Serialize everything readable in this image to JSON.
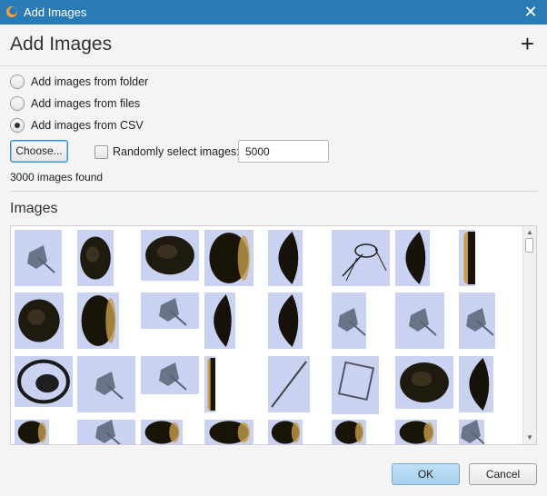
{
  "window": {
    "title": "Add Images",
    "close_glyph": "✕"
  },
  "header": {
    "heading": "Add Images",
    "add_glyph": "+"
  },
  "options": [
    {
      "label": "Add images from folder",
      "checked": false
    },
    {
      "label": "Add images from files",
      "checked": false
    },
    {
      "label": "Add images from CSV",
      "checked": true
    }
  ],
  "choose_button": "Choose...",
  "random": {
    "label": "Randomly select images:",
    "checked": false,
    "value": "5000"
  },
  "status": "3000 images found",
  "images_section": {
    "title": "Images"
  },
  "thumbnails": [
    {
      "kind": "plankton"
    },
    {
      "kind": "dark-round"
    },
    {
      "kind": "dark-round"
    },
    {
      "kind": "dark-oval"
    },
    {
      "kind": "dark-lens"
    },
    {
      "kind": "copepod"
    },
    {
      "kind": "dark-lens"
    },
    {
      "kind": "dark-sliver"
    },
    {
      "kind": "dark-round"
    },
    {
      "kind": "dark-oval"
    },
    {
      "kind": "plankton"
    },
    {
      "kind": "dark-lens"
    },
    {
      "kind": "dark-lens"
    },
    {
      "kind": "plankton"
    },
    {
      "kind": "plankton"
    },
    {
      "kind": "plankton"
    },
    {
      "kind": "ring"
    },
    {
      "kind": "plankton"
    },
    {
      "kind": "plankton"
    },
    {
      "kind": "dark-sliver"
    },
    {
      "kind": "needle"
    },
    {
      "kind": "square"
    },
    {
      "kind": "dark-round"
    },
    {
      "kind": "dark-lens"
    },
    {
      "kind": "dark-oval"
    },
    {
      "kind": "plankton"
    },
    {
      "kind": "dark-oval"
    },
    {
      "kind": "dark-oval"
    },
    {
      "kind": "dark-oval"
    },
    {
      "kind": "dark-oval"
    },
    {
      "kind": "dark-oval"
    },
    {
      "kind": "plankton"
    }
  ],
  "footer": {
    "ok": "OK",
    "cancel": "Cancel"
  },
  "colors": {
    "titlebar": "#2a7ab6",
    "ok_button": "#a6d0ee",
    "thumb_bg": "#c9d2f0"
  }
}
